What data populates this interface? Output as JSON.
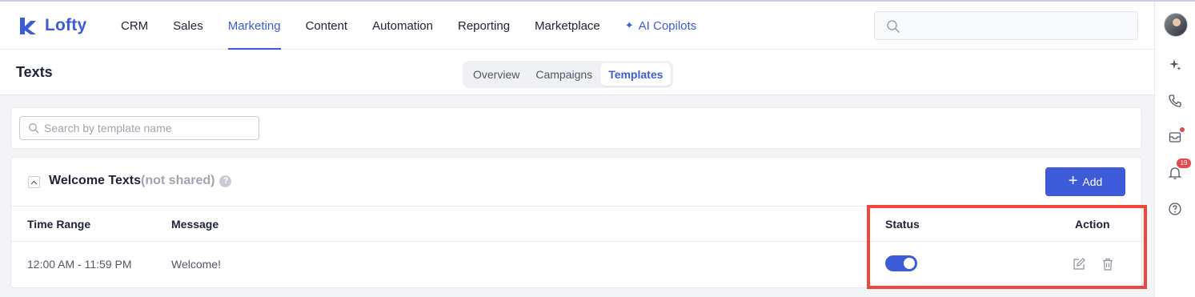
{
  "header": {
    "logo_text": "Lofty",
    "nav": [
      {
        "label": "CRM"
      },
      {
        "label": "Sales"
      },
      {
        "label": "Marketing"
      },
      {
        "label": "Content"
      },
      {
        "label": "Automation"
      },
      {
        "label": "Reporting"
      },
      {
        "label": "Marketplace"
      },
      {
        "label": "AI Copilots"
      }
    ],
    "active_nav": "Marketing",
    "accent": "#3d5bd8"
  },
  "rail": {
    "icons": [
      "avatar",
      "sparkle-icon",
      "phone-icon",
      "inbox-icon",
      "bell-icon",
      "help-icon"
    ],
    "bell_count": "19"
  },
  "page": {
    "title": "Texts",
    "tabs": [
      {
        "label": "Overview"
      },
      {
        "label": "Campaigns"
      },
      {
        "label": "Templates"
      }
    ],
    "active_tab": "Templates"
  },
  "search": {
    "placeholder": "Search by template name"
  },
  "group": {
    "title": "Welcome Texts",
    "subtitle": "(not shared)",
    "add_label": "Add",
    "columns": {
      "time_range": "Time Range",
      "message": "Message",
      "status": "Status",
      "action": "Action"
    },
    "rows": [
      {
        "time_range": "12:00 AM - 11:59 PM",
        "message": "Welcome!",
        "status_on": true
      }
    ]
  },
  "highlight_color": "#f0463c"
}
